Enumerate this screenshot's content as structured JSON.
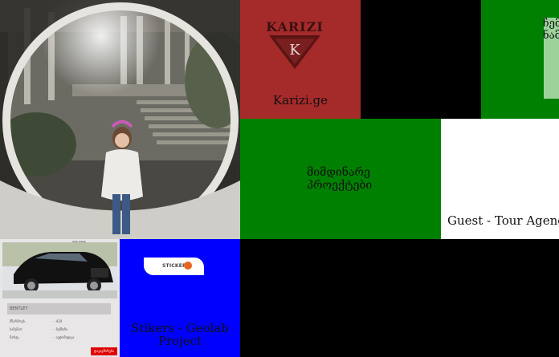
{
  "tiles": {
    "karizi": {
      "logo_word": "KARIZI",
      "logo_letter": "K",
      "caption": "Karizi.ge"
    },
    "green_top": {
      "line1": "ჩემ",
      "line2": "ნამ"
    },
    "current_projects": {
      "caption": "მიმდინარე პროექტები"
    },
    "guest": {
      "caption": "Guest - Tour Agency"
    },
    "car_ad": {
      "brand": "BENTLEY",
      "header": "▮▮▮ ▮▮▮▮",
      "rows": [
        {
          "label": "მწარმოებ.",
          "value": "- 420"
        },
        {
          "label": "სამუშაო",
          "value": "- ბენზინი"
        },
        {
          "label": "მარჯვ.",
          "value": "- ავტომატიკა"
        }
      ],
      "button": "დაკავშირება"
    },
    "stickers": {
      "logo_text": "STICKER",
      "caption": "Stikers - Geolab Project"
    }
  },
  "colors": {
    "karizi_bg": "#a52a2a",
    "green": "#008000",
    "blue": "#0000ff",
    "black": "#000000",
    "white": "#ffffff"
  }
}
